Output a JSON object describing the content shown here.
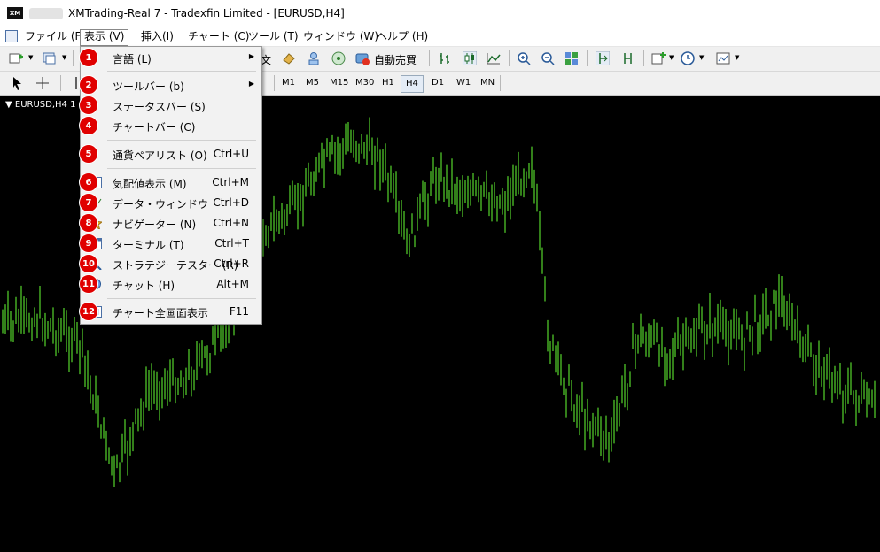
{
  "window": {
    "app_icon": "XM",
    "title": "XMTrading-Real 7 - Tradexfin Limited - [EURUSD,H4]"
  },
  "menubar": {
    "items": [
      {
        "label": "ファイル (F)"
      },
      {
        "label": "表示 (V)"
      },
      {
        "label": "挿入(I)"
      },
      {
        "label": "チャート (C)"
      },
      {
        "label": "ツール (T)"
      },
      {
        "label": "ウィンドウ (W)"
      },
      {
        "label": "ヘルプ (H)"
      }
    ]
  },
  "toolbar1": {
    "text_icon": "文",
    "autotrade_label": "自動売買",
    "icons": [
      "new-chart-icon",
      "profiles-icon",
      "text-tool-icon",
      "eraser-icon",
      "person-icon",
      "signal-icon",
      "autotrade-icon",
      "bar-chart-icon",
      "candles-icon",
      "line-chart-icon",
      "zoom-in-icon",
      "zoom-out-icon",
      "tile-icon",
      "chart-shift-icon",
      "autoscroll-icon",
      "indicators-icon",
      "periods-icon",
      "templates-icon"
    ]
  },
  "toolbar2": {
    "timeframes": [
      "M1",
      "M5",
      "M15",
      "M30",
      "H1",
      "H4",
      "D1",
      "W1",
      "MN"
    ],
    "selected": "H4"
  },
  "chart": {
    "label": "EURUSD,H4",
    "label_suffix": "1",
    "candle_color": "#66ff33",
    "background": "#000000"
  },
  "view_menu": {
    "items": [
      {
        "badge": "1",
        "label": "言語 (L)",
        "shortcut": "",
        "submenu": true,
        "checked": false
      },
      {
        "badge": "2",
        "label": "ツールバー (b)",
        "shortcut": "",
        "submenu": true,
        "checked": false
      },
      {
        "badge": "3",
        "label": "ステータスバー (S)",
        "shortcut": "",
        "submenu": false,
        "checked": true
      },
      {
        "badge": "4",
        "label": "チャートバー (C)",
        "shortcut": "",
        "submenu": false,
        "checked": true
      },
      {
        "badge": "5",
        "label": "通貨ペアリスト (O)",
        "shortcut": "Ctrl+U",
        "submenu": false,
        "checked": false
      },
      {
        "badge": "6",
        "label": "気配値表示 (M)",
        "shortcut": "Ctrl+M",
        "submenu": false,
        "checked": false
      },
      {
        "badge": "7",
        "label": "データ・ウィンドウ",
        "shortcut": "Ctrl+D",
        "submenu": false,
        "checked": false
      },
      {
        "badge": "8",
        "label": "ナビゲーター (N)",
        "shortcut": "Ctrl+N",
        "submenu": false,
        "checked": false
      },
      {
        "badge": "9",
        "label": "ターミナル (T)",
        "shortcut": "Ctrl+T",
        "submenu": false,
        "checked": false
      },
      {
        "badge": "10",
        "label": "ストラテジーテスター (R)",
        "shortcut": "Ctrl+R",
        "submenu": false,
        "checked": false
      },
      {
        "badge": "11",
        "label": "チャット (H)",
        "shortcut": "Alt+M",
        "submenu": false,
        "checked": false
      },
      {
        "badge": "12",
        "label": "チャート全画面表示",
        "shortcut": "F11",
        "submenu": false,
        "checked": false
      }
    ],
    "check_glyph": "✓",
    "arrow_glyph": "▶"
  }
}
